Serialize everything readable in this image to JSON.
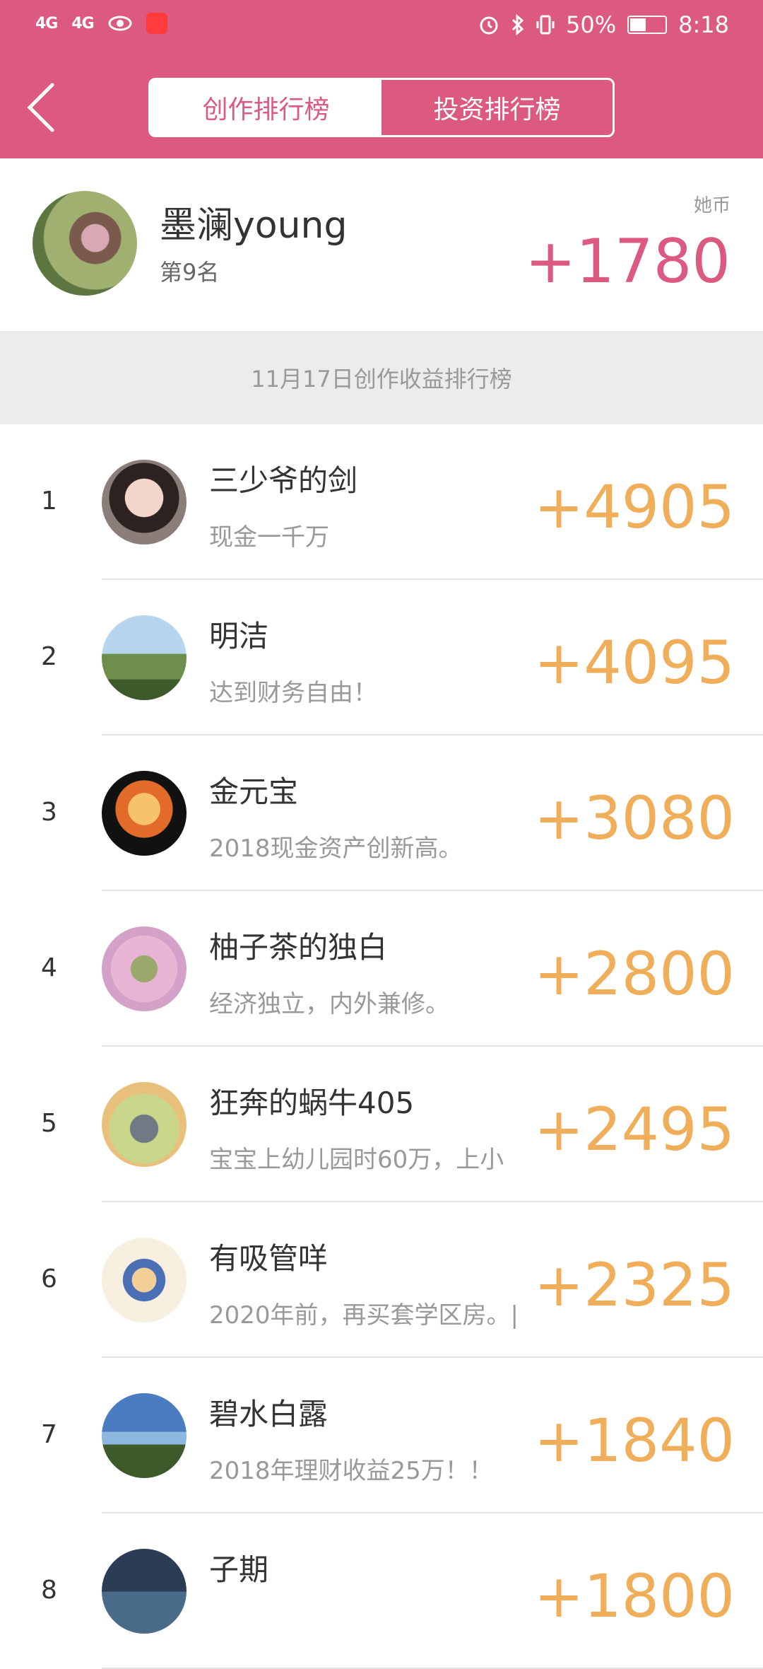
{
  "status_bar": {
    "left_signal_1": "4G",
    "left_signal_2": "4G",
    "battery_percent": "50%",
    "battery_level": 0.5,
    "time": "8:18"
  },
  "header": {
    "tabs": [
      {
        "label": "创作排行榜",
        "active": true
      },
      {
        "label": "投资排行榜",
        "active": false
      }
    ]
  },
  "me": {
    "name": "墨澜young",
    "rank_text": "第9名",
    "coin_label": "她币",
    "score": "+1780"
  },
  "banner_text": "11月17日创作收益排行榜",
  "rows": [
    {
      "rank": "1",
      "title": "三少爷的剑",
      "desc": "现金一千万",
      "value": "+4905"
    },
    {
      "rank": "2",
      "title": "明洁",
      "desc": "达到财务自由！",
      "value": "+4095"
    },
    {
      "rank": "3",
      "title": "金元宝",
      "desc": "2018现金资产创新高。",
      "value": "+3080"
    },
    {
      "rank": "4",
      "title": "柚子茶的独白",
      "desc": "经济独立，内外兼修。",
      "value": "+2800"
    },
    {
      "rank": "5",
      "title": "狂奔的蜗牛405",
      "desc": "宝宝上幼儿园时60万，上小",
      "value": "+2495"
    },
    {
      "rank": "6",
      "title": "有吸管咩",
      "desc": "2020年前，再买套学区房。|",
      "value": "+2325"
    },
    {
      "rank": "7",
      "title": "碧水白露",
      "desc": "2018年理财收益25万！！",
      "value": "+1840"
    },
    {
      "rank": "8",
      "title": "子期",
      "desc": "",
      "value": "+1800"
    }
  ],
  "colors": {
    "brand": "#dc5a7f",
    "value": "#f0ae5a"
  }
}
